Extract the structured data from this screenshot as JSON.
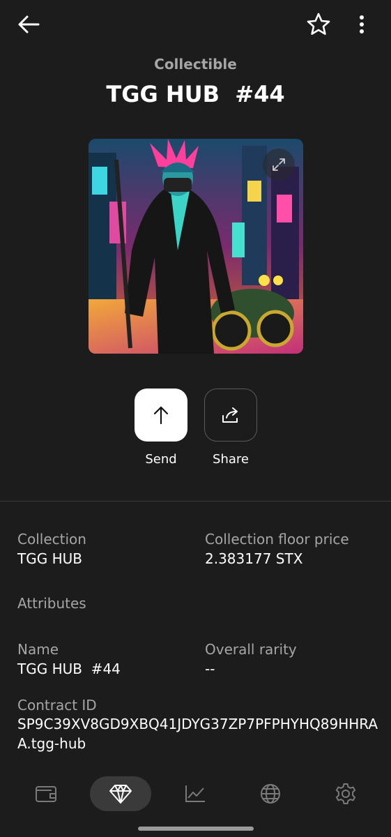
{
  "header": {
    "back_icon": "arrow-left-icon",
    "favorite_icon": "star-icon",
    "more_icon": "more-vertical-icon"
  },
  "subtitle": "Collectible",
  "title": "TGG HUB  #44",
  "image": {
    "expand_icon": "expand-icon"
  },
  "actions": {
    "send_label": "Send",
    "share_label": "Share"
  },
  "details": {
    "collection_label": "Collection",
    "collection_value": "TGG HUB",
    "floor_label": "Collection floor price",
    "floor_value": "2.383177 STX",
    "attributes_label": "Attributes",
    "name_label": "Name",
    "name_value": "TGG HUB  #44",
    "rarity_label": "Overall rarity",
    "rarity_value": "--",
    "contract_label": "Contract ID",
    "contract_value": "SP9C39XV8GD9XBQ41JDYG37ZP7PFPHYHQ89HHRAA.tgg-hub"
  },
  "navbar": {
    "items": [
      {
        "icon": "wallet-icon",
        "active": false
      },
      {
        "icon": "diamond-icon",
        "active": true
      },
      {
        "icon": "chart-icon",
        "active": false
      },
      {
        "icon": "globe-icon",
        "active": false
      },
      {
        "icon": "gear-icon",
        "active": false
      }
    ]
  },
  "colors": {
    "background": "#1c1c1c",
    "secondary_text": "#a6a6a6",
    "send_button": "#ffffff",
    "active_nav": "#3a3a3a"
  }
}
